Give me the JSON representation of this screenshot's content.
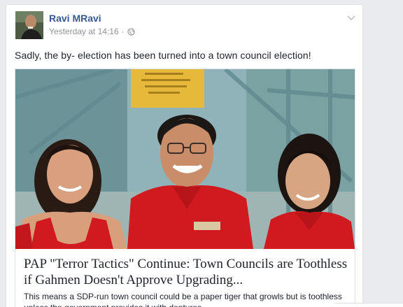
{
  "post": {
    "author": "Ravi MRavi",
    "timestamp": "Yesterday at 14:16",
    "separator": "·",
    "privacy_icon": "globe-icon",
    "menu_icon": "chevron-down-icon",
    "text": "Sadly, the by- election has been turned into a town council election!"
  },
  "link_preview": {
    "title": "PAP \"Terror Tactics\" Continue: Town Councils are Toothless if Gahmen Doesn't Approve Upgrading...",
    "description": "This means a SDP-run town council could be a paper tiger that growls but is toothless unless the government provides it with dentures."
  },
  "colors": {
    "link_blue": "#365899",
    "meta_grey": "#90949c",
    "text": "#1d2129",
    "shirt_red": "#d11a1f"
  }
}
